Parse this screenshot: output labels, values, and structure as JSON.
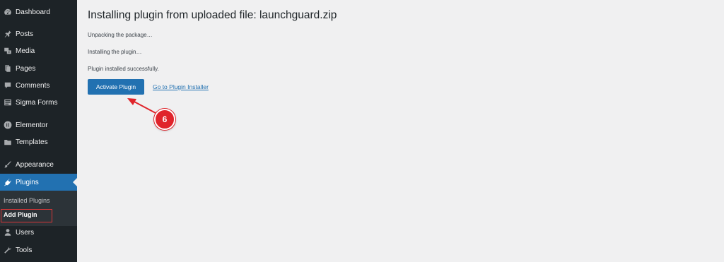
{
  "sidebar": {
    "items": [
      {
        "label": "Dashboard",
        "icon": "dashboard-icon"
      },
      {
        "label": "Posts",
        "icon": "pin-icon"
      },
      {
        "label": "Media",
        "icon": "media-icon"
      },
      {
        "label": "Pages",
        "icon": "pages-icon"
      },
      {
        "label": "Comments",
        "icon": "comments-icon"
      },
      {
        "label": "Sigma Forms",
        "icon": "forms-icon"
      },
      {
        "label": "Elementor",
        "icon": "elementor-icon"
      },
      {
        "label": "Templates",
        "icon": "folder-icon"
      },
      {
        "label": "Appearance",
        "icon": "brush-icon"
      },
      {
        "label": "Plugins",
        "icon": "plugin-icon"
      },
      {
        "label": "Users",
        "icon": "user-icon"
      },
      {
        "label": "Tools",
        "icon": "wrench-icon"
      }
    ],
    "submenu": {
      "installed_plugins": "Installed Plugins",
      "add_plugin": "Add Plugin"
    },
    "active_color": "#2271b1",
    "background": "#1d2327"
  },
  "main": {
    "title": "Installing plugin from uploaded file: launchguard.zip",
    "messages": [
      "Unpacking the package…",
      "Installing the plugin…",
      "Plugin installed successfully."
    ],
    "activate_button": "Activate Plugin",
    "installer_link": "Go to Plugin Installer"
  },
  "annotation": {
    "step_number": "6",
    "color": "#e0242b"
  }
}
